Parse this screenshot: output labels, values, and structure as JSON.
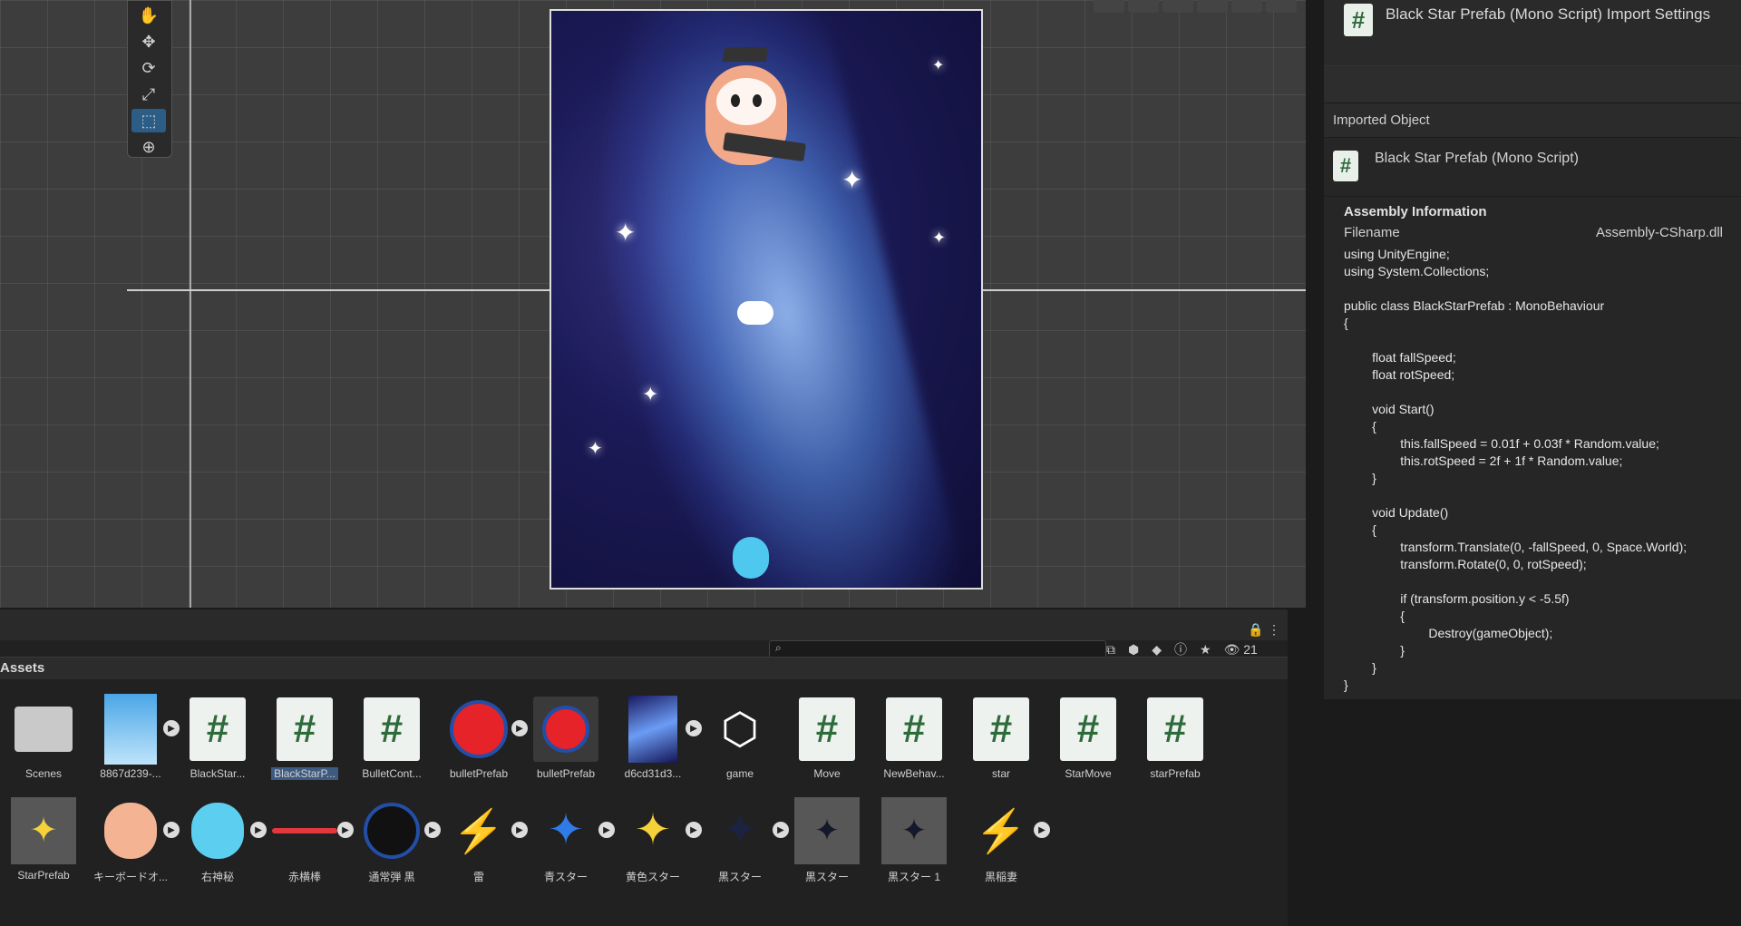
{
  "inspector": {
    "title": "Black Star Prefab (Mono Script) Import Settings",
    "imported_object_label": "Imported Object",
    "imported_object_name": "Black Star Prefab (Mono Script)",
    "assembly_heading": "Assembly Information",
    "filename_label": "Filename",
    "filename_value": "Assembly-CSharp.dll",
    "code_lines": [
      "using UnityEngine;",
      "using System.Collections;",
      "",
      "public class BlackStarPrefab : MonoBehaviour",
      "{",
      "",
      "        float fallSpeed;",
      "        float rotSpeed;",
      "",
      "        void Start()",
      "        {",
      "                this.fallSpeed = 0.01f + 0.03f * Random.value;",
      "                this.rotSpeed = 2f + 1f * Random.value;",
      "        }",
      "",
      "        void Update()",
      "        {",
      "                transform.Translate(0, -fallSpeed, 0, Space.World);",
      "                transform.Rotate(0, 0, rotSpeed);",
      "",
      "                if (transform.position.y < -5.5f)",
      "                {",
      "                        Destroy(gameObject);",
      "                }",
      "        }",
      "}"
    ]
  },
  "assets": {
    "title": "Assets",
    "hidden_count": "21",
    "row1": [
      {
        "label": "Scenes",
        "kind": "folder"
      },
      {
        "label": "8867d239-...",
        "kind": "image-sky",
        "play": true
      },
      {
        "label": "BlackStar...",
        "kind": "script"
      },
      {
        "label": "BlackStarP...",
        "kind": "script",
        "selected": true
      },
      {
        "label": "BulletCont...",
        "kind": "script"
      },
      {
        "label": "bulletPrefab",
        "kind": "red-circle",
        "play": true
      },
      {
        "label": "bulletPrefab",
        "kind": "red-circle-box"
      },
      {
        "label": "d6cd31d3...",
        "kind": "image-galaxy",
        "play": true
      },
      {
        "label": "game",
        "kind": "unity"
      },
      {
        "label": "Move",
        "kind": "script"
      },
      {
        "label": "NewBehav...",
        "kind": "script"
      },
      {
        "label": "star",
        "kind": "script"
      },
      {
        "label": "StarMove",
        "kind": "script"
      },
      {
        "label": "starPrefab",
        "kind": "script"
      }
    ],
    "row2": [
      {
        "label": "StarPrefab",
        "kind": "star-yellow-box"
      },
      {
        "label": "キーボードオ...",
        "kind": "owl",
        "play": true
      },
      {
        "label": "右神秘",
        "kind": "owl-blue",
        "play": true
      },
      {
        "label": "赤横棒",
        "kind": "red-bar",
        "play": true
      },
      {
        "label": "通常弾 黒",
        "kind": "dark-circle",
        "play": true
      },
      {
        "label": "雷",
        "kind": "bolt",
        "play": true
      },
      {
        "label": "青スター",
        "kind": "star-blue",
        "play": true
      },
      {
        "label": "黄色スター",
        "kind": "star-yellow",
        "play": true
      },
      {
        "label": "黒スター",
        "kind": "star-black",
        "play": true
      },
      {
        "label": "黒スター",
        "kind": "star-black-box"
      },
      {
        "label": "黒スター 1",
        "kind": "star-black-box"
      },
      {
        "label": "黒稲妻",
        "kind": "bolt-black",
        "play": true
      }
    ]
  },
  "colors": {
    "script_hash": "#2d6a3a",
    "selection": "#3d5a80",
    "tool_active": "#2c5d87"
  }
}
